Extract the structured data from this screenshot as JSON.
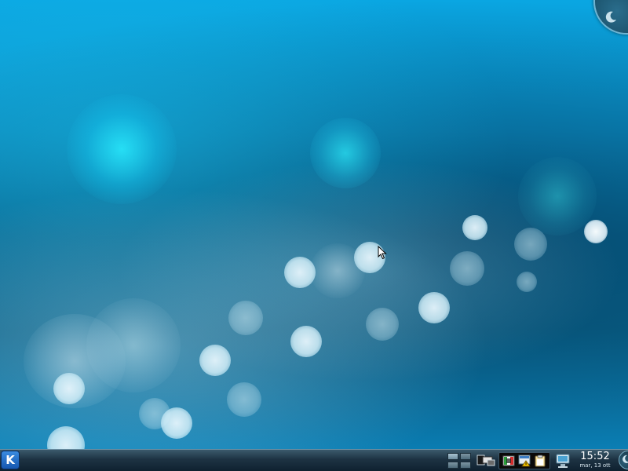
{
  "desktop": {
    "wallpaper_name": "KDE 4.0 default (Oxygen) wallpaper"
  },
  "top_right": {
    "cashew_icon": "plasma-toolbox-icon"
  },
  "panel": {
    "kmenu_icon": "kde-logo-icon",
    "kmenu_label": "K",
    "pager": {
      "desktops": 4,
      "active": 1
    },
    "show_desktop_icon": "show-desktop-icon",
    "systray": {
      "icons": [
        "calendar-flag-icon",
        "warning-notification-icon",
        "clipboard-icon"
      ]
    },
    "notifier_icon": "device-notifier-icon",
    "clock": {
      "time": "15:52",
      "date": "mar, 13 ott"
    },
    "panel_cashew_icon": "panel-toolbox-icon"
  },
  "colors": {
    "sky_top": "#0aa6e2",
    "deep": "#0a6891",
    "panel_bg": "#1d3343",
    "kmenu_blue": "#1657b0"
  }
}
